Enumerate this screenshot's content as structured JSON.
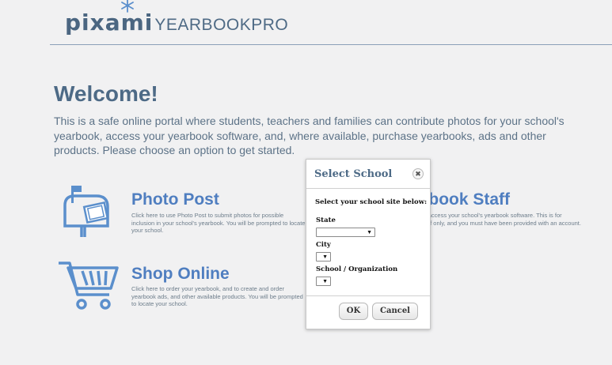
{
  "header": {
    "logo_main": "pixami",
    "logo_sub": "YEARBOOKPRO"
  },
  "welcome": {
    "title": "Welcome!",
    "text": "This is a safe online portal where students, teachers and families can contribute photos for your school's yearbook, access your yearbook software, and, where available, purchase yearbooks, ads and other products. Please choose an option to get started."
  },
  "cards": {
    "photo_post": {
      "title": "Photo Post",
      "desc": "Click here to use Photo Post to submit photos for possible inclusion in your school's yearbook. You will be prompted to locate your school."
    },
    "yearbook_staff": {
      "title": "Yearbook Staff",
      "desc": "Click here to access your school's yearbook software. This is for yearbook Staff only, and you must have been provided with an account."
    },
    "shop_online": {
      "title": "Shop Online",
      "desc": "Click here to order your yearbook, and to create and order yearbook ads, and other available products. You will be prompted to locate your school."
    }
  },
  "dialog": {
    "title": "Select School",
    "close_glyph": "✖",
    "instruction": "Select your school site below:",
    "fields": {
      "state_label": "State",
      "city_label": "City",
      "school_label": "School / Organization",
      "dropdown_glyph": "▼"
    },
    "buttons": {
      "ok": "OK",
      "cancel": "Cancel"
    }
  },
  "colors": {
    "brand": "#4b6681",
    "accent_blue": "#4f7ec0",
    "icon_blue": "#5b8fcc",
    "background": "#f1f1f2"
  },
  "icons": [
    "star-icon",
    "mailbox-photo-icon",
    "shopping-cart-icon",
    "close-icon",
    "dropdown-arrow-icon"
  ]
}
